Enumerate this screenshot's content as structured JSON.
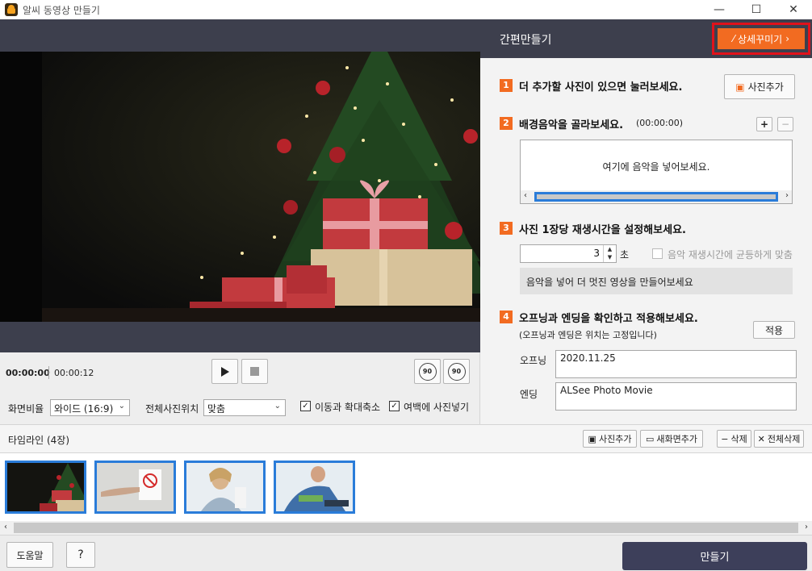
{
  "window": {
    "title": "알씨 동영상 만들기",
    "minimize": "—",
    "maximize": "☐",
    "close": "✕"
  },
  "player": {
    "current_time": "00:00:00",
    "total_time": "00:00:12",
    "rotate_left_label": "90",
    "rotate_right_label": "90"
  },
  "options": {
    "ratio_label": "화면비율",
    "ratio_value": "와이드 (16:9)",
    "position_label": "전체사진위치",
    "position_value": "맞춤",
    "move_zoom_label": "이동과 확대축소",
    "move_zoom_checked": true,
    "fill_margin_label": "여백에 사진넣기",
    "fill_margin_checked": true
  },
  "panel": {
    "title": "간편만들기",
    "detail_button": "상세꾸미기",
    "step1": {
      "num": "1",
      "text": "더 추가할 사진이 있으면 눌러보세요.",
      "button": "사진추가"
    },
    "step2": {
      "num": "2",
      "text": "배경음악을 골라보세요.",
      "duration": "(00:00:00)",
      "add": "+",
      "remove": "−",
      "placeholder": "여기에 음악을 넣어보세요."
    },
    "step3": {
      "num": "3",
      "text": "사진 1장당 재생시간을 설정해보세요.",
      "value": "3",
      "unit": "초",
      "fit_music_label": "음악 재생시간에 균등하게 맞춤",
      "hint": "음악을 넣어 더 멋진 영상을 만들어보세요"
    },
    "step4": {
      "num": "4",
      "text": "오프닝과 엔딩을 확인하고 적용해보세요.",
      "sub": "(오프닝과 엔딩은 위치는 고정입니다)",
      "apply": "적용",
      "opening_label": "오프닝",
      "opening_value": "2020.11.25",
      "ending_label": "엔딩",
      "ending_value": "ALSee Photo Movie"
    }
  },
  "timeline": {
    "title": "타임라인 (4장)",
    "add_photo": "사진추가",
    "add_screen": "새화면추가",
    "delete": "삭제",
    "delete_all": "전체삭제",
    "thumbnails": [
      "christmas-gifts",
      "no-smoking-sign",
      "stressed-woman",
      "person-with-phone"
    ]
  },
  "footer": {
    "help": "도움말",
    "question": "?",
    "make": "만들기"
  },
  "colors": {
    "accent": "#f26b21",
    "dark": "#3d3f4d",
    "highlight": "#e0121b",
    "selection": "#2a7cd9"
  }
}
